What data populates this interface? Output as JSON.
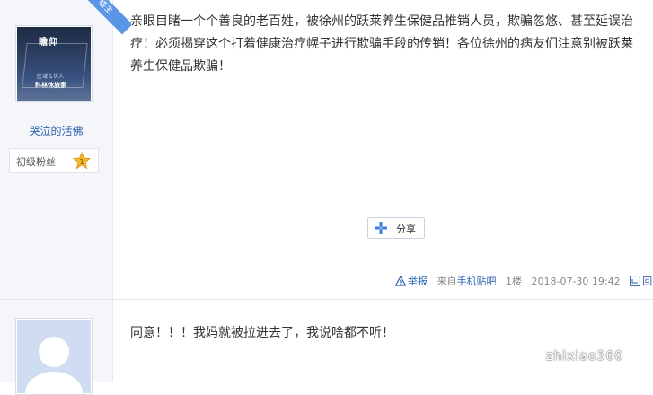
{
  "post1": {
    "ribbon_label": "楼主",
    "author": {
      "name": "哭泣的活佛",
      "level": "初级粉丝",
      "level_number": "1",
      "avatar_text": {
        "logo": "瞻仰",
        "line1": "区域合伙人",
        "line2": "科林休旅家"
      }
    },
    "content": "亲眼目睹一个个善良的老百姓，被徐州的跃莱养生保健品推销人员，欺骗忽悠、甚至延误治疗！必须揭穿这个打着健康治疗幌子进行欺骗手段的传销！各位徐州的病友们注意别被跃莱养生保健品欺骗！",
    "share_label": "分享",
    "meta": {
      "report": "举报",
      "from_prefix": "来自",
      "from_source": "手机贴吧",
      "floor": "1楼",
      "timestamp": "2018-07-30 19:42",
      "reply": "回复"
    }
  },
  "post2": {
    "content": "同意！！！我妈就被拉进去了，我说啥都不听！"
  },
  "watermark": {
    "text": "zhixiao360"
  },
  "colors": {
    "link": "#2b63b0",
    "sidebar_bg": "#f4f6f9",
    "ribbon": "#5b95e6",
    "star": "#f6b72b"
  }
}
